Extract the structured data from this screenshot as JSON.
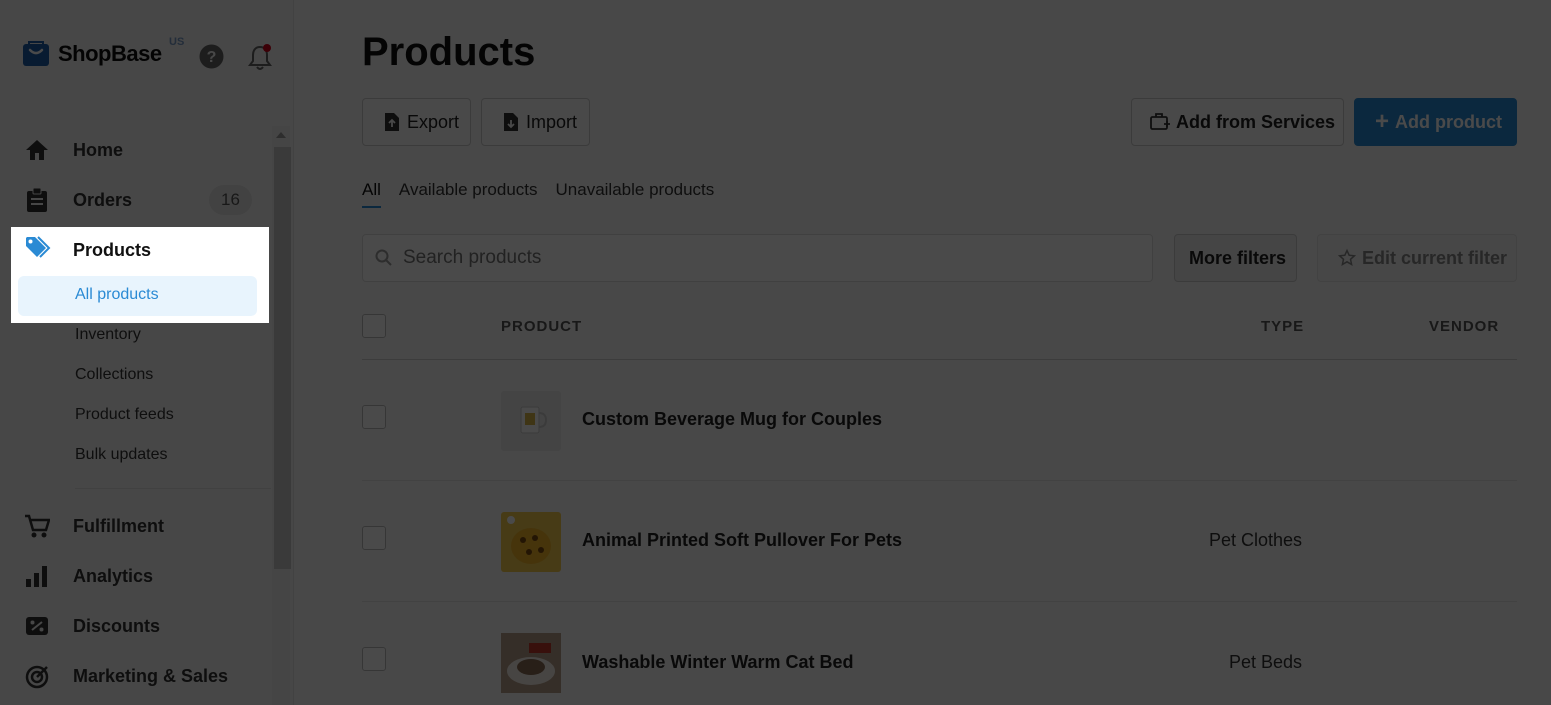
{
  "brand": {
    "name": "ShopBase",
    "region": "US"
  },
  "sidebar": {
    "items": [
      {
        "label": "Home",
        "icon": "home-icon"
      },
      {
        "label": "Orders",
        "icon": "clipboard-icon",
        "badge": "16"
      },
      {
        "label": "Products",
        "icon": "tag-icon"
      },
      {
        "label": "Fulfillment",
        "icon": "cart-icon"
      },
      {
        "label": "Analytics",
        "icon": "bar-chart-icon"
      },
      {
        "label": "Discounts",
        "icon": "discount-icon"
      },
      {
        "label": "Marketing & Sales",
        "icon": "target-icon"
      }
    ],
    "product_sub": [
      "All products",
      "Inventory",
      "Collections",
      "Product feeds",
      "Bulk updates"
    ]
  },
  "main": {
    "title": "Products",
    "buttons": {
      "export": "Export",
      "import": "Import",
      "add_from_services": "Add from Services",
      "add_product": "Add product"
    },
    "tabs": [
      "All",
      "Available products",
      "Unavailable products"
    ],
    "search": {
      "placeholder": "Search products"
    },
    "filters": {
      "more": "More filters",
      "edit": "Edit current filter"
    },
    "table": {
      "headers": [
        "PRODUCT",
        "TYPE",
        "VENDOR"
      ],
      "rows": [
        {
          "name": "Custom Beverage Mug for Couples",
          "type": ""
        },
        {
          "name": "Animal Printed Soft Pullover For Pets",
          "type": "Pet Clothes"
        },
        {
          "name": "Washable Winter Warm Cat Bed",
          "type": "Pet Beds"
        }
      ]
    }
  },
  "colors": {
    "accent": "#2a8ad4",
    "overlay": "rgba(0,0,0,0.46)"
  }
}
